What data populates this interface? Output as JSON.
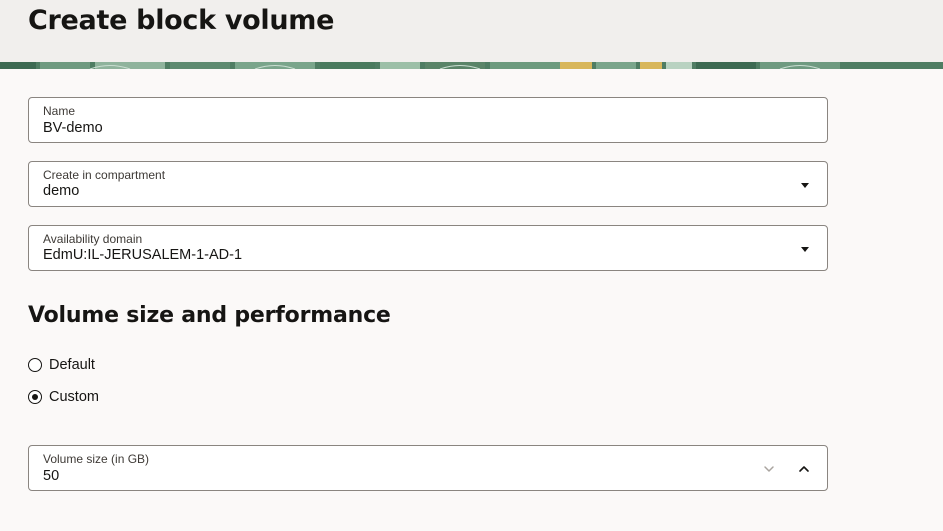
{
  "header": {
    "title": "Create block volume"
  },
  "form": {
    "name": {
      "label": "Name",
      "value": "BV-demo"
    },
    "compartment": {
      "label": "Create in compartment",
      "value": "demo"
    },
    "availability_domain": {
      "label": "Availability domain",
      "value": "EdmU:IL-JERUSALEM-1-AD-1"
    }
  },
  "volume_section": {
    "title": "Volume size and performance",
    "options": [
      {
        "label": "Default",
        "selected": false
      },
      {
        "label": "Custom",
        "selected": true
      }
    ],
    "volume_size": {
      "label": "Volume size (in GB)",
      "value": "50"
    }
  },
  "icons": {
    "dropdown": "caret-down-icon",
    "decrement": "chevron-down-icon",
    "increment": "chevron-up-icon"
  },
  "colors": {
    "banner_green": "#4f7d63",
    "banner_gold": "#d8b65a",
    "border": "#8a8580",
    "background": "#fbf9f8"
  }
}
